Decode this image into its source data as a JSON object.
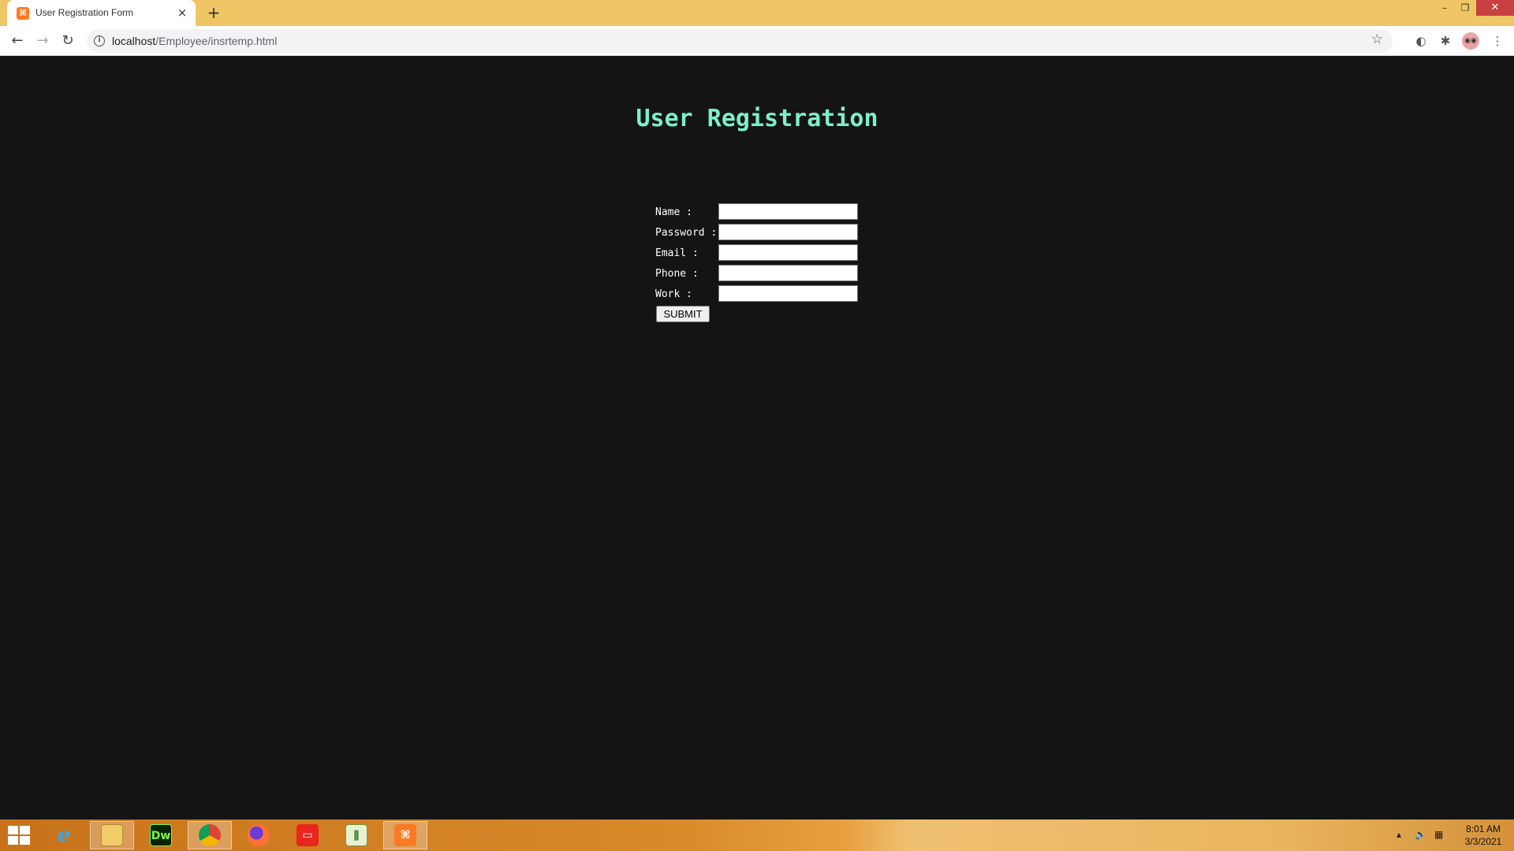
{
  "browser": {
    "tab_title": "User Registration Form",
    "tab_favicon": "xampp-icon",
    "tab_close": "×",
    "new_tab": "+",
    "url_host": "localhost",
    "url_path": "/Employee/insrtemp.html",
    "window_minimize": "–",
    "window_restore": "❐",
    "window_close": "✕"
  },
  "page": {
    "title": "User Registration",
    "fields": [
      {
        "label": "Name :",
        "value": ""
      },
      {
        "label": "Password :",
        "value": ""
      },
      {
        "label": "Email :",
        "value": ""
      },
      {
        "label": "Phone :",
        "value": ""
      },
      {
        "label": "Work :",
        "value": ""
      }
    ],
    "submit_label": "SUBMIT"
  },
  "taskbar": {
    "apps": [
      "internet-explorer",
      "file-explorer",
      "dreamweaver",
      "chrome",
      "firefox",
      "oracle",
      "task-manager",
      "xampp"
    ],
    "dreamweaver_label": "Dw",
    "clock_time": "8:01 AM",
    "clock_date": "3/3/2021"
  },
  "colors": {
    "titlebar": "#efc566",
    "page_background": "#141414",
    "title_text": "#7cf0c8",
    "label_text": "#ffffff"
  }
}
